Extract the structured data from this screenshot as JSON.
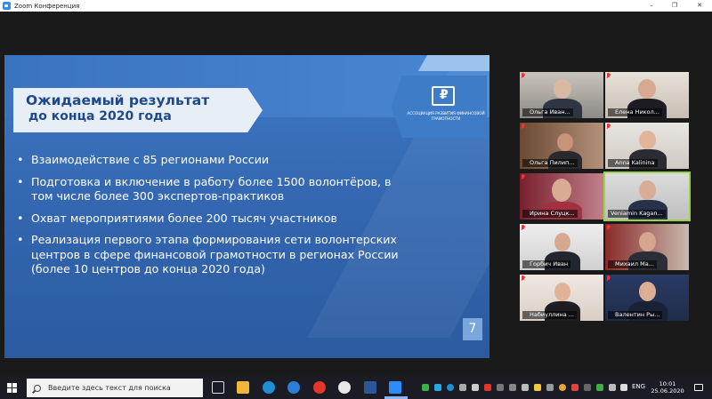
{
  "window": {
    "title": "Zoom Конференция",
    "controls": [
      "–",
      "❐",
      "✕"
    ]
  },
  "slide": {
    "title_line1": "Ожидаемый результат",
    "title_line2": "до конца 2020 года",
    "logo_caption": "АССОЦИАЦИЯ РАЗВИТИЯ ФИНАНСОВОЙ ГРАМОТНОСТИ",
    "logo_symbol": "₽",
    "bullets": [
      "Взаимодействие с 85 регионами России",
      "Подготовка и включение в работу более 1500 волонтёров, в том числе более 300 экспертов-практиков",
      "Охват мероприятиями более 200 тысяч участников",
      "Реализация первого этапа  формирования сети волонтерских центров в сфере финансовой грамотности  в регионах России (более 10 центров до конца 2020 года)"
    ],
    "page_number": "7"
  },
  "participants": [
    {
      "name": "Ольга Иван...",
      "muted": true
    },
    {
      "name": "Елена Никол...",
      "muted": true
    },
    {
      "name": "Ольга Пилип...",
      "muted": true
    },
    {
      "name": "Anna Kalinina",
      "muted": true
    },
    {
      "name": "Ирина Слуцк...",
      "muted": true
    },
    {
      "name": "Veniamin Kagan...",
      "muted": false,
      "active": true
    },
    {
      "name": "Горбич Иван",
      "muted": true
    },
    {
      "name": "Михаил Ма...",
      "muted": true
    },
    {
      "name": "Набиуллина ...",
      "muted": true
    },
    {
      "name": "Валентин Ры...",
      "muted": true
    }
  ],
  "taskbar": {
    "search_placeholder": "Введите здесь текст для поиска",
    "language": "ENG",
    "time": "10:01",
    "date": "25.06.2020"
  },
  "colors": {
    "slide_blue": "#3468b2",
    "title_text": "#1e4a8a",
    "active_speaker": "#9bd34a",
    "taskbar": "#1b1b24"
  }
}
